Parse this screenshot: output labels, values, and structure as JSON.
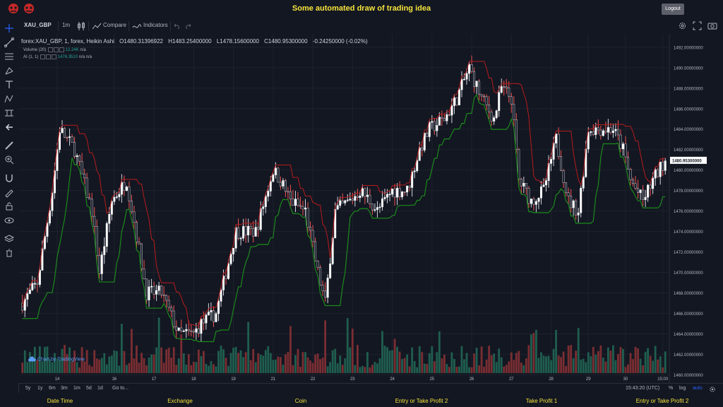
{
  "app": {
    "title": "Some automated draw of trading idea",
    "logout_label": "Logout"
  },
  "toolbar": {
    "symbol": "XAU_GBP",
    "interval": "1m",
    "compare_label": "Compare",
    "indicators_label": "Indicators"
  },
  "legend": {
    "main": "forex:XAU_GBP, 1, forex, Heikin Ashi",
    "open": "O1480.31396922",
    "high": "H1483.25400000",
    "low": "L1478.15600000",
    "close": "C1480.95300000",
    "change": "-0.24250000 (-0.02%)",
    "volume_label": "Volume (20)",
    "volume_value": "12.24K",
    "volume_na": "n/a",
    "ai_label": "AI (1, 1)",
    "ai_value": "1476.3510",
    "ai_na1": "n/a",
    "ai_na2": "n/a"
  },
  "watermark": "Chart by TradingView",
  "bottom": {
    "ranges": [
      "5y",
      "1y",
      "6m",
      "3m",
      "1m",
      "5d",
      "1d"
    ],
    "goto_label": "Go to...",
    "time": "15:43:20 (UTC)",
    "percent": "%",
    "log": "log",
    "auto": "auto"
  },
  "footer": {
    "labels": [
      "Date Time",
      "Exchange",
      "Coin",
      "Entry or Take Profit 2",
      "Take Profit 1",
      "Entry or Take Profit 2"
    ]
  },
  "colors": {
    "up": "#26a69a",
    "down": "#ef5350",
    "candle_body_up": "#ffffff",
    "candle_body_down": "#131722",
    "red_line": "#b71c1c",
    "green_line": "#1b8a1b",
    "accent": "#f5e33b",
    "price_label_bg": "#ffffff"
  },
  "chart_data": {
    "type": "line",
    "style": "heikin-ashi-candles-with-two-indicator-lines-and-volume",
    "ylim": [
      1459.2,
      1493.3
    ],
    "y_ticks": [
      "1492.00000000",
      "1490.00000000",
      "1488.00000000",
      "1486.00000000",
      "1484.00000000",
      "1482.00000000",
      "1480.00000000",
      "1478.00000000",
      "1476.00000000",
      "1474.00000000",
      "1472.00000000",
      "1470.00000000",
      "1468.00000000",
      "1466.00000000",
      "1464.00000000",
      "1462.00000000",
      "1460.00000000"
    ],
    "y_tick_values": [
      1492,
      1490,
      1488,
      1486,
      1484,
      1482,
      1480,
      1478,
      1476,
      1474,
      1472,
      1470,
      1468,
      1466,
      1464,
      1462,
      1460
    ],
    "current_price": 1480.953,
    "current_price_label": "1480.95300000",
    "x_ticks": [
      {
        "label": "14",
        "index": 14
      },
      {
        "label": "16",
        "index": 37
      },
      {
        "label": "17",
        "index": 53
      },
      {
        "label": "18",
        "index": 69
      },
      {
        "label": "19",
        "index": 85
      },
      {
        "label": "21",
        "index": 101
      },
      {
        "label": "22",
        "index": 117
      },
      {
        "label": "23",
        "index": 133
      },
      {
        "label": "24",
        "index": 149
      },
      {
        "label": "25",
        "index": 165
      },
      {
        "label": "26",
        "index": 181
      },
      {
        "label": "27",
        "index": 197
      },
      {
        "label": "28",
        "index": 213
      },
      {
        "label": "29",
        "index": 228
      },
      {
        "label": "30",
        "index": 243
      },
      {
        "label": "15:00",
        "index": 258
      }
    ],
    "n_candles": 260,
    "path": [
      [
        0,
        1467
      ],
      [
        6,
        1469
      ],
      [
        12,
        1478
      ],
      [
        15,
        1484
      ],
      [
        21,
        1482
      ],
      [
        28,
        1476
      ],
      [
        31,
        1470
      ],
      [
        36,
        1477
      ],
      [
        42,
        1479
      ],
      [
        45,
        1475
      ],
      [
        50,
        1468
      ],
      [
        56,
        1468
      ],
      [
        63,
        1464
      ],
      [
        69,
        1464
      ],
      [
        72,
        1465
      ],
      [
        78,
        1466
      ],
      [
        82,
        1470
      ],
      [
        86,
        1474
      ],
      [
        94,
        1474
      ],
      [
        101,
        1480
      ],
      [
        104,
        1479
      ],
      [
        108,
        1477
      ],
      [
        114,
        1476
      ],
      [
        119,
        1470
      ],
      [
        122,
        1467
      ],
      [
        126,
        1476
      ],
      [
        132,
        1477
      ],
      [
        136,
        1478
      ],
      [
        140,
        1477
      ],
      [
        143,
        1476
      ],
      [
        149,
        1478
      ],
      [
        155,
        1478
      ],
      [
        160,
        1482
      ],
      [
        164,
        1484
      ],
      [
        170,
        1485
      ],
      [
        175,
        1487
      ],
      [
        180,
        1490
      ],
      [
        185,
        1487
      ],
      [
        190,
        1485
      ],
      [
        193,
        1488
      ],
      [
        197,
        1487
      ],
      [
        200,
        1479
      ],
      [
        205,
        1477
      ],
      [
        210,
        1478
      ],
      [
        215,
        1483
      ],
      [
        220,
        1477
      ],
      [
        224,
        1476
      ],
      [
        228,
        1484
      ],
      [
        232,
        1484
      ],
      [
        238,
        1484
      ],
      [
        242,
        1482
      ],
      [
        245,
        1479
      ],
      [
        250,
        1477
      ],
      [
        254,
        1479
      ],
      [
        259,
        1481
      ]
    ]
  }
}
